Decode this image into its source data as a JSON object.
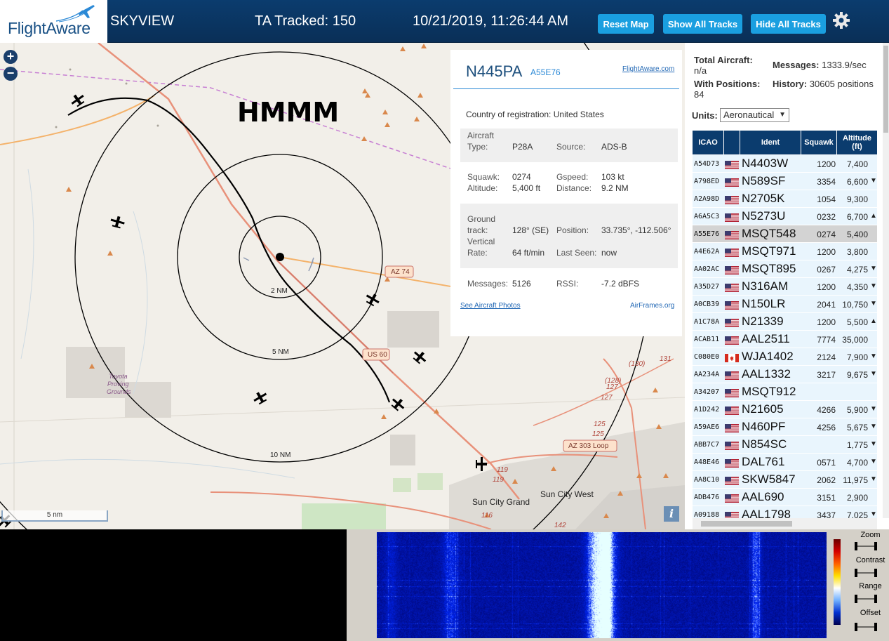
{
  "header": {
    "logo_text_a": "Flight",
    "logo_text_b": "Aware",
    "app_title": "SKYVIEW",
    "tracked": "TA Tracked: 150",
    "datetime": "10/21/2019, 11:26:44 AM",
    "buttons": [
      "Reset Map",
      "Show All Tracks",
      "Hide All Tracks"
    ]
  },
  "map": {
    "annotation": "HMMM",
    "zoom_in": "+",
    "zoom_out": "−",
    "ring_labels": [
      "2 NM",
      "5 NM",
      "10 NM"
    ],
    "road_labels": [
      "AZ 74",
      "US 60",
      "AZ 303 Loop"
    ],
    "route_numbers": [
      "(130)",
      "131",
      "(128)",
      "127",
      "127",
      "125",
      "125",
      "119",
      "119",
      "116",
      "142"
    ],
    "place_labels": [
      "Toyota",
      "Proving",
      "Grounds",
      "Sun City Grand",
      "Sun City West"
    ],
    "scale_label": "5 nm",
    "info_btn": "i",
    "colors": {
      "land": "#f2efe9",
      "primary_road": "#e8917a",
      "secondary_road": "#f4b26a",
      "urban": "#d9d5cf",
      "boundary": "#c77fd3"
    }
  },
  "popup": {
    "callsign": "N445PA",
    "hex": "A55E76",
    "link": "FlightAware.com",
    "country_label": "Country of registration:",
    "country": "United States",
    "aircraft_type_label": "Aircraft Type:",
    "aircraft_type": "P28A",
    "source_label": "Source:",
    "source": "ADS-B",
    "squawk_label": "Squawk:",
    "squawk": "0274",
    "gspeed_label": "Gspeed:",
    "gspeed": "103 kt",
    "altitude_label": "Altitude:",
    "altitude": "5,400 ft",
    "distance_label": "Distance:",
    "distance": "9.2 NM",
    "ground_track_label": "Ground track:",
    "ground_track": "128° (SE)",
    "position_label": "Position:",
    "position": "33.735°, -112.506°",
    "vertical_rate_label": "Vertical Rate:",
    "vertical_rate": "64 ft/min",
    "last_seen_label": "Last Seen:",
    "last_seen": "now",
    "messages_label": "Messages:",
    "messages": "5126",
    "rssi_label": "RSSI:",
    "rssi": "-7.2 dBFS",
    "photos_link": "See Aircraft Photos",
    "airframes_link": "AirFrames.org"
  },
  "panel": {
    "total_label": "Total Aircraft:",
    "total_value": "n/a",
    "messages_label": "Messages:",
    "messages_value": "1333.9/sec",
    "positions_label": "With Positions:",
    "positions_value": "84",
    "history_label": "History:",
    "history_value": "30605 positions",
    "units_label": "Units:",
    "units_value": "Aeronautical",
    "columns": [
      "ICAO",
      "Ident",
      "Squawk",
      "Altitude (ft)"
    ],
    "rows": [
      {
        "icao": "A54D73",
        "flag": "us",
        "ident": "N4403W",
        "squawk": "1200",
        "alt": "7,400",
        "arrow": ""
      },
      {
        "icao": "A798ED",
        "flag": "us",
        "ident": "N589SF",
        "squawk": "3354",
        "alt": "6,600",
        "arrow": "▼"
      },
      {
        "icao": "A2A98D",
        "flag": "us",
        "ident": "N2705K",
        "squawk": "1054",
        "alt": "9,300",
        "arrow": ""
      },
      {
        "icao": "A6A5C3",
        "flag": "us",
        "ident": "N5273U",
        "squawk": "0232",
        "alt": "6,700",
        "arrow": "▲"
      },
      {
        "icao": "A55E76",
        "flag": "us",
        "ident": "MSQT548",
        "squawk": "0274",
        "alt": "5,400",
        "arrow": "",
        "selected": true
      },
      {
        "icao": "A4E62A",
        "flag": "us",
        "ident": "MSQT971",
        "squawk": "1200",
        "alt": "3,800",
        "arrow": ""
      },
      {
        "icao": "AA02AC",
        "flag": "us",
        "ident": "MSQT895",
        "squawk": "0267",
        "alt": "4,275",
        "arrow": "▼"
      },
      {
        "icao": "A35D27",
        "flag": "us",
        "ident": "N316AM",
        "squawk": "1200",
        "alt": "4,350",
        "arrow": "▼"
      },
      {
        "icao": "A0CB39",
        "flag": "us",
        "ident": "N150LR",
        "squawk": "2041",
        "alt": "10,750",
        "arrow": "▼"
      },
      {
        "icao": "A1C78A",
        "flag": "us",
        "ident": "N21339",
        "squawk": "1200",
        "alt": "5,500",
        "arrow": "▲"
      },
      {
        "icao": "ACAB11",
        "flag": "us",
        "ident": "AAL2511",
        "squawk": "7774",
        "alt": "35,000",
        "arrow": ""
      },
      {
        "icao": "C080E0",
        "flag": "ca",
        "ident": "WJA1402",
        "squawk": "2124",
        "alt": "7,900",
        "arrow": "▼"
      },
      {
        "icao": "AA234A",
        "flag": "us",
        "ident": "AAL1332",
        "squawk": "3217",
        "alt": "9,675",
        "arrow": "▼"
      },
      {
        "icao": "A34207",
        "flag": "us",
        "ident": "MSQT912",
        "squawk": "",
        "alt": "",
        "arrow": ""
      },
      {
        "icao": "A1D242",
        "flag": "us",
        "ident": "N21605",
        "squawk": "4266",
        "alt": "5,900",
        "arrow": "▼"
      },
      {
        "icao": "A59AE6",
        "flag": "us",
        "ident": "N460PF",
        "squawk": "4256",
        "alt": "5,675",
        "arrow": "▼"
      },
      {
        "icao": "ABB7C7",
        "flag": "us",
        "ident": "N854SC",
        "squawk": "",
        "alt": "1,775",
        "arrow": "▼"
      },
      {
        "icao": "A48E46",
        "flag": "us",
        "ident": "DAL761",
        "squawk": "0571",
        "alt": "4,700",
        "arrow": "▼"
      },
      {
        "icao": "AA8C10",
        "flag": "us",
        "ident": "SKW5847",
        "squawk": "2062",
        "alt": "11,975",
        "arrow": "▼"
      },
      {
        "icao": "ADB476",
        "flag": "us",
        "ident": "AAL690",
        "squawk": "3151",
        "alt": "2,900",
        "arrow": ""
      },
      {
        "icao": "A09188",
        "flag": "us",
        "ident": "AAL1798",
        "squawk": "3437",
        "alt": "7,025",
        "arrow": "▼"
      }
    ]
  },
  "waterfall": {
    "controls": [
      "Zoom",
      "Contrast",
      "Range",
      "Offset"
    ]
  }
}
